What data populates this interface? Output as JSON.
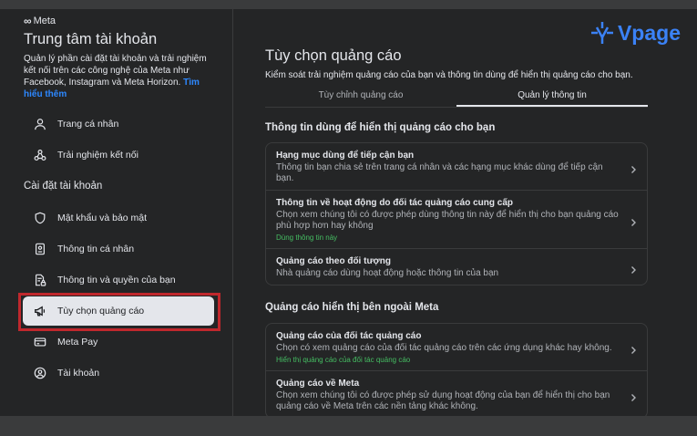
{
  "sidebar": {
    "brand": "Meta",
    "title": "Trung tâm tài khoản",
    "description": "Quản lý phần cài đặt tài khoản và trải nghiệm kết nối trên các công nghệ của Meta như Facebook, Instagram và Meta Horizon.",
    "link": "Tìm hiểu thêm",
    "top_items": [
      {
        "label": "Trang cá nhân",
        "icon": "user-icon"
      },
      {
        "label": "Trải nghiệm kết nối",
        "icon": "connected-icon"
      }
    ],
    "section_label": "Cài đặt tài khoản",
    "settings_items": [
      {
        "label": "Mật khẩu và bảo mật",
        "icon": "shield-icon"
      },
      {
        "label": "Thông tin cá nhân",
        "icon": "id-card-icon"
      },
      {
        "label": "Thông tin và quyền của bạn",
        "icon": "doc-lock-icon"
      },
      {
        "label": "Tùy chọn quảng cáo",
        "icon": "megaphone-icon",
        "active": true
      },
      {
        "label": "Meta Pay",
        "icon": "card-icon"
      },
      {
        "label": "Tài khoản",
        "icon": "account-circle-icon"
      }
    ]
  },
  "watermark": {
    "text": "Vpage"
  },
  "main": {
    "title": "Tùy chọn quảng cáo",
    "subtitle": "Kiểm soát trải nghiệm quảng cáo của bạn và thông tin dùng để hiển thị quảng cáo cho bạn.",
    "tabs": [
      {
        "label": "Tùy chỉnh quảng cáo",
        "active": false
      },
      {
        "label": "Quản lý thông tin",
        "active": true
      }
    ],
    "group1": {
      "heading": "Thông tin dùng để hiển thị quảng cáo cho bạn",
      "rows": [
        {
          "title": "Hạng mục dùng để tiếp cận bạn",
          "desc": "Thông tin bạn chia sẻ trên trang cá nhân và các hạng mục khác dùng để tiếp cận bạn.",
          "status": ""
        },
        {
          "title": "Thông tin về hoạt động do đối tác quảng cáo cung cấp",
          "desc": "Chọn xem chúng tôi có được phép dùng thông tin này để hiển thị cho bạn quảng cáo phù hợp hơn hay không",
          "status": "Dùng thông tin này"
        },
        {
          "title": "Quảng cáo theo đối tượng",
          "desc": "Nhà quảng cáo dùng hoạt động hoặc thông tin của bạn",
          "status": ""
        }
      ]
    },
    "group2": {
      "heading": "Quảng cáo hiển thị bên ngoài Meta",
      "rows": [
        {
          "title": "Quảng cáo của đối tác quảng cáo",
          "desc": "Chọn có xem quảng cáo của đối tác quảng cáo trên các ứng dụng khác hay không.",
          "status": "Hiển thị quảng cáo của đối tác quảng cáo"
        },
        {
          "title": "Quảng cáo về Meta",
          "desc": "Chọn xem chúng tôi có được phép sử dụng hoạt động của bạn để hiển thị cho bạn quảng cáo về Meta trên các nền tảng khác không.",
          "status": ""
        }
      ]
    }
  },
  "colors": {
    "background": "#242526",
    "active_item": "#e4e6eb",
    "highlight_border": "#c0282d",
    "link": "#2d88ff",
    "status_green": "#45bd62",
    "watermark_blue": "#3b82f6"
  }
}
